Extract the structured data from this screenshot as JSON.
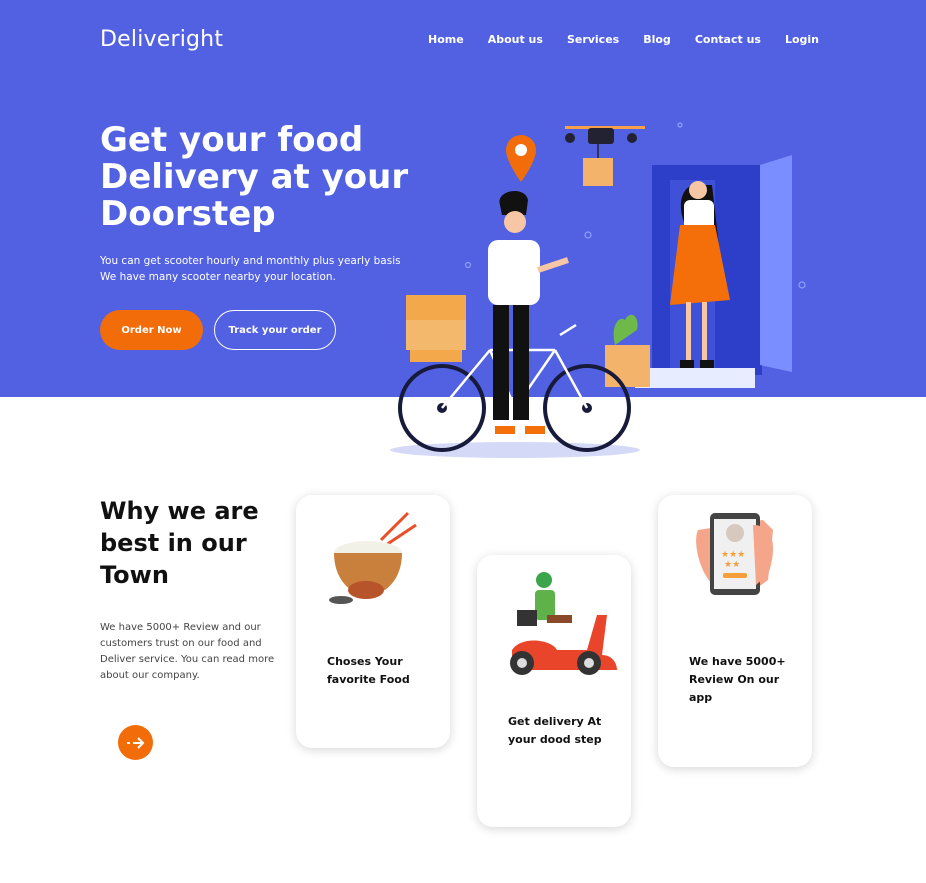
{
  "brand": {
    "logo": "Deliveright"
  },
  "nav": {
    "items": [
      "Home",
      "About us",
      "Services",
      "Blog",
      "Contact us",
      "Login"
    ]
  },
  "hero": {
    "title": "Get your food Delivery at your Doorstep",
    "subtitle_line1": "You can get scooter hourly and monthly plus yearly basis",
    "subtitle_line2": "We have many scooter nearby your location.",
    "primary_button": "Order Now",
    "secondary_button": "Track your order"
  },
  "why": {
    "title": "Why we are best in our Town",
    "text": "We have 5000+ Review and our customers trust on our food and Deliver service. You can read more about our company."
  },
  "cards": [
    {
      "icon": "food-bowl-icon",
      "text": "Choses Your favorite Food"
    },
    {
      "icon": "scooter-rider-icon",
      "text": "Get delivery At your dood step"
    },
    {
      "icon": "phone-review-icon",
      "text": "We have 5000+ Review On our app"
    }
  ],
  "colors": {
    "hero_bg": "#5161e1",
    "accent": "#f26d0a",
    "text_dark": "#111111"
  }
}
